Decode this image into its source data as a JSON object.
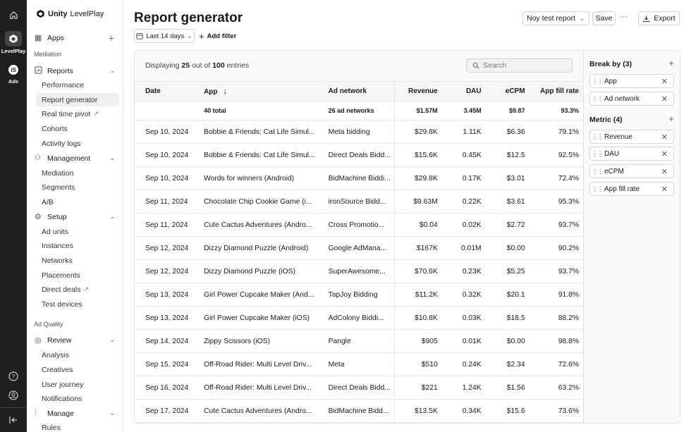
{
  "rail": {
    "items": [
      {
        "label": "",
        "icon": "home-icon"
      },
      {
        "label": "LevelPlay",
        "icon": "levelplay-icon"
      },
      {
        "label": "Ads",
        "icon": "ads-icon"
      }
    ],
    "bottom": [
      "help-icon",
      "account-icon",
      "collapse-icon"
    ]
  },
  "sidebar": {
    "brand": "Unity",
    "brand_product": "LevelPlay",
    "apps": "Apps",
    "sections": {
      "mediation": "Mediation",
      "ad_quality": "Ad Quality"
    },
    "reports": {
      "label": "Reports",
      "items": [
        "Performance",
        "Report generator",
        "Real time pivot",
        "Cohorts",
        "Activity logs"
      ]
    },
    "management": {
      "label": "Management",
      "items": [
        "Mediation",
        "Segments",
        "A/B"
      ]
    },
    "setup": {
      "label": "Setup",
      "items": [
        "Ad units",
        "Instances",
        "Networks",
        "Placements",
        "Direct deals",
        "Test devices"
      ]
    },
    "review": {
      "label": "Review",
      "items": [
        "Analysis",
        "Creatives",
        "User journey",
        "Notifications"
      ]
    },
    "manage": {
      "label": "Manage",
      "items": [
        "Rules"
      ]
    }
  },
  "header": {
    "title": "Report generator",
    "report_select": "Noy test report",
    "save": "Save",
    "more": "···",
    "export": "Export",
    "date_filter": "Last 14 days",
    "add_filter": "Add filter"
  },
  "table": {
    "displaying_prefix": "Displaying",
    "displaying_count": "25",
    "displaying_mid": "out of",
    "displaying_total": "100",
    "displaying_suffix": "entries",
    "search_placeholder": "Search",
    "columns": [
      "Date",
      "App",
      "Ad network",
      "Revenue",
      "DAU",
      "eCPM",
      "App fill rate"
    ],
    "totals": [
      "",
      "40 total",
      "26 ad networks",
      "$1.57M",
      "3.45M",
      "$9.87",
      "93.3%"
    ],
    "rows": [
      [
        "Sep 10, 2024",
        "Bobbie & Friends: Cat Life Simul...",
        "Meta bidding",
        "$29.8K",
        "1.11K",
        "$6.36",
        "79.1%"
      ],
      [
        "Sep 10, 2024",
        "Bobbie & Friends: Cat Life Simul...",
        "Direct Deals Bidd...",
        "$15.6K",
        "0.45K",
        "$12.5",
        "92.5%"
      ],
      [
        "Sep 10, 2024",
        "Words for winners (Android)",
        "BidMachine Biddi...",
        "$29.8K",
        "0.17K",
        "$3.01",
        "72.4%"
      ],
      [
        "Sep 11, 2024",
        "Chocolate Chip Cookie Game (i...",
        "ironSource Bidd...",
        "$9.63M",
        "0.22K",
        "$3.61",
        "95.3%"
      ],
      [
        "Sep 11, 2024",
        "Cute Cactus Adventures (Andro...",
        "Cross Promotio...",
        "$0.04",
        "0.02K",
        "$2.72",
        "93.7%"
      ],
      [
        "Sep 12, 2024",
        "Dizzy Diamond Puzzle (Android)",
        "Google AdMana...",
        "$167K",
        "0.01M",
        "$0.00",
        "90.2%"
      ],
      [
        "Sep 12, 2024",
        "Dizzy Diamond Puzzle (iOS)",
        "SuperAwesome...",
        "$70.6K",
        "0.23K",
        "$5.25",
        "93.7%"
      ],
      [
        "Sep 13, 2024",
        "Girl Power Cupcake Maker (And...",
        "TapJoy Bidding",
        "$11.2K",
        "0.32K",
        "$20.1",
        "91.8%"
      ],
      [
        "Sep 13, 2024",
        "Girl Power Cupcake Maker (iOS)",
        "AdColony Biddi...",
        "$10.8K",
        "0.03K",
        "$18.5",
        "88.2%"
      ],
      [
        "Sep 14, 2024",
        "Zippy Scissors (iOS)",
        "Pangle",
        "$905",
        "0.01K",
        "$0.00",
        "98.8%"
      ],
      [
        "Sep 15, 2024",
        "Off-Road Rider: Multi Level Driv...",
        "Meta",
        "$510",
        "0.24K",
        "$2.34",
        "72.6%"
      ],
      [
        "Sep 16, 2024",
        "Off-Road Rider: Multi Level Driv...",
        "Direct Deals Bidd...",
        "$221",
        "1.24K",
        "$1.56",
        "63.2%"
      ],
      [
        "Sep 17, 2024",
        "Cute Cactus Adventures (Andro...",
        "BidMachine Bidd...",
        "$13.5K",
        "0.34K",
        "$15.6",
        "73.6%"
      ]
    ]
  },
  "breakdown": {
    "break_by_title": "Break by (3)",
    "break_by": [
      "App",
      "Ad network"
    ],
    "metric_title": "Metric (4)",
    "metrics": [
      "Revenue",
      "DAU",
      "eCPM",
      "App fill rate"
    ]
  }
}
